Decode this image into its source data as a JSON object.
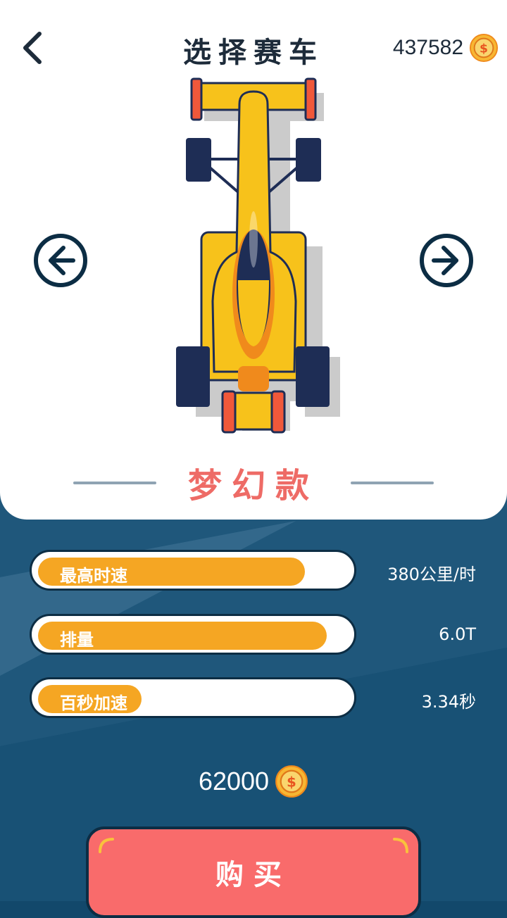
{
  "header": {
    "title": "选择赛车",
    "coin_balance": "437582"
  },
  "car": {
    "name": "梦幻款",
    "colors": {
      "body": "#f7c21b",
      "accent": "#f08a1c",
      "wing_tip": "#f0583a",
      "tire": "#1e2d55"
    }
  },
  "stats": [
    {
      "label": "最高时速",
      "value": "380公里/时",
      "fill": 0.85
    },
    {
      "label": "排量",
      "value": "6.0T",
      "fill": 0.92
    },
    {
      "label": "百秒加速",
      "value": "3.34秒",
      "fill": 0.33
    }
  ],
  "price": {
    "amount": "62000"
  },
  "buy_button": {
    "label": "购买"
  },
  "icons": {
    "back": "chevron-left-icon",
    "prev": "arrow-left-circle-icon",
    "next": "arrow-right-circle-icon",
    "coin": "dollar-coin-icon"
  },
  "colors": {
    "accent": "#f5a623",
    "buy": "#f96b6b",
    "background": "#12486b",
    "name": "#ee6b66"
  }
}
